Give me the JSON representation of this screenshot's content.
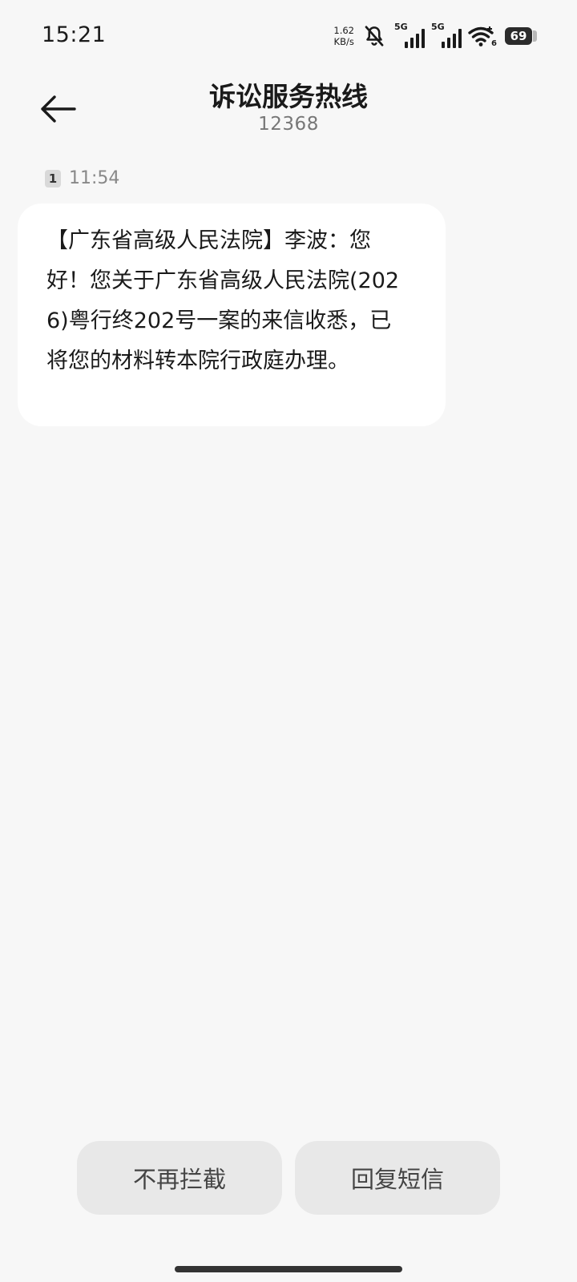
{
  "status_bar": {
    "time": "15:21",
    "net_speed_value": "1.62",
    "net_speed_unit": "KB/s",
    "sim1_type": "5G",
    "sim2_type": "5G",
    "wifi_sub": "6",
    "battery_level": "69",
    "icons": [
      "bell-muted-icon",
      "signal-icon",
      "signal-icon",
      "wifi-icon",
      "battery-icon"
    ]
  },
  "header": {
    "back_icon": "arrow-left-icon",
    "title": "诉讼服务热线",
    "number": "12368"
  },
  "message": {
    "sim_badge": "1",
    "time": "11:54",
    "text": "【广东省高级人民法院】李波：您好！您关于广东省高级人民法院(2026)粤行终202号一案的来信收悉，已将您的材料转本院行政庭办理。"
  },
  "actions": {
    "unblock_label": "不再拦截",
    "reply_label": "回复短信"
  }
}
